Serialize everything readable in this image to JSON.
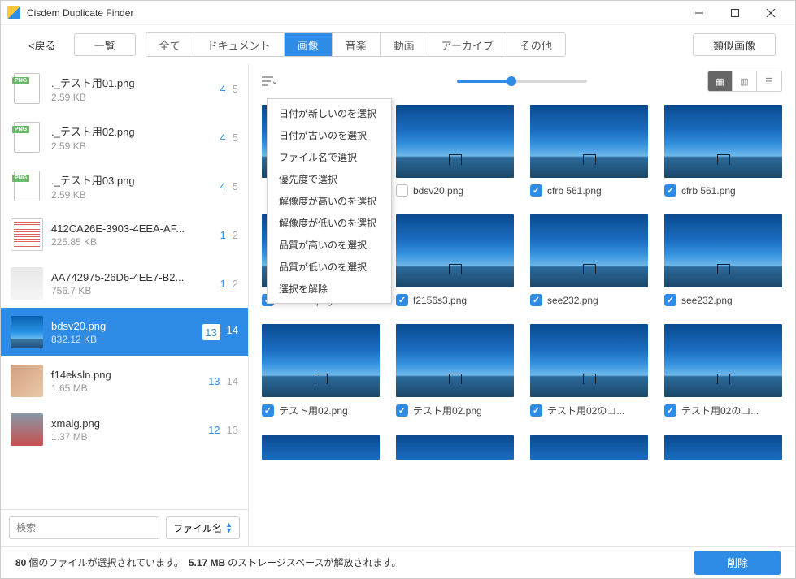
{
  "app": {
    "title": "Cisdem Duplicate Finder"
  },
  "toolbar": {
    "back": "<戻る",
    "overview": "一覧",
    "tabs": [
      "全て",
      "ドキュメント",
      "画像",
      "音楽",
      "動画",
      "アーカイブ",
      "その他"
    ],
    "active_tab": 2,
    "similar": "類似画像"
  },
  "sidebar": {
    "search_placeholder": "検索",
    "sort_label": "ファイル名",
    "items": [
      {
        "name": "._テスト用01.png",
        "size": "2.59 KB",
        "sel": "4",
        "tot": "5",
        "thumb": "png"
      },
      {
        "name": "._テスト用02.png",
        "size": "2.59 KB",
        "sel": "4",
        "tot": "5",
        "thumb": "png"
      },
      {
        "name": "._テスト用03.png",
        "size": "2.59 KB",
        "sel": "4",
        "tot": "5",
        "thumb": "png"
      },
      {
        "name": "412CA26E-3903-4EEA-AF...",
        "size": "225.85 KB",
        "sel": "1",
        "tot": "2",
        "thumb": "doc"
      },
      {
        "name": "AA742975-26D6-4EE7-B2...",
        "size": "756.7 KB",
        "sel": "1",
        "tot": "2",
        "thumb": "gray"
      },
      {
        "name": "bdsv20.png",
        "size": "832.12 KB",
        "sel": "13",
        "tot": "14",
        "thumb": "img",
        "selected": true
      },
      {
        "name": "f14eksln.png",
        "size": "1.65 MB",
        "sel": "13",
        "tot": "14",
        "thumb": "photo"
      },
      {
        "name": "xmalg.png",
        "size": "1.37 MB",
        "sel": "12",
        "tot": "13",
        "thumb": "photo2"
      }
    ]
  },
  "grid": {
    "items": [
      {
        "label": "",
        "checked": false,
        "hidden_label": true
      },
      {
        "label": "bdsv20.png",
        "checked": false
      },
      {
        "label": "cfrb 561.png",
        "checked": true
      },
      {
        "label": "cfrb 561.png",
        "checked": true
      },
      {
        "label": "f2156s3.png",
        "checked": true
      },
      {
        "label": "f2156s3.png",
        "checked": true
      },
      {
        "label": "see232.png",
        "checked": true
      },
      {
        "label": "see232.png",
        "checked": true
      },
      {
        "label": "テスト用02.png",
        "checked": true
      },
      {
        "label": "テスト用02.png",
        "checked": true
      },
      {
        "label": "テスト用02のコ...",
        "checked": true
      },
      {
        "label": "テスト用02のコ...",
        "checked": true
      }
    ],
    "partial": [
      1,
      1,
      0,
      0
    ]
  },
  "context_menu": [
    "日付が新しいのを選択",
    "日付が古いのを選択",
    "ファイル名で選択",
    "優先度で選択",
    "解像度が高いのを選択",
    "解像度が低いのを選択",
    "品質が高いのを選択",
    "品質が低いのを選択",
    "選択を解除"
  ],
  "footer": {
    "count": "80",
    "text1": "個のファイルが選択されています。",
    "size": "5.17 MB",
    "text2": "のストレージスペースが解放されます。",
    "delete": "削除"
  }
}
